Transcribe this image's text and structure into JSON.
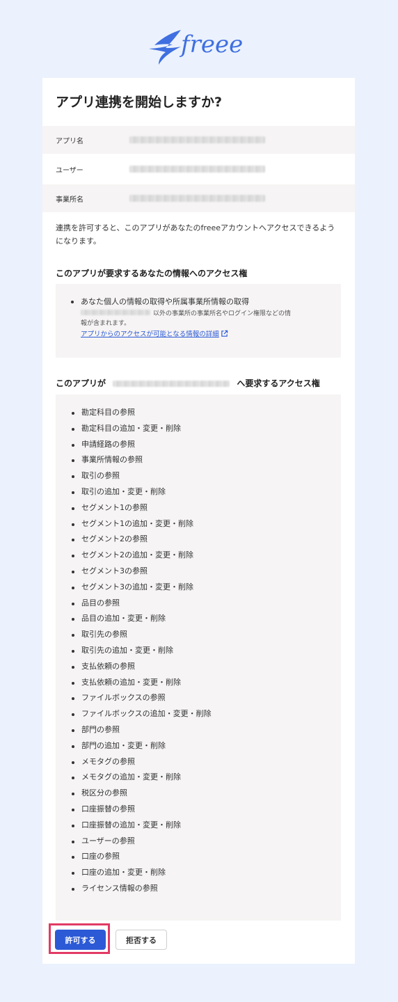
{
  "brand": {
    "name": "freee",
    "color": "#3f6fe0"
  },
  "page": {
    "title": "アプリ連携を開始しますか?"
  },
  "info": [
    {
      "label": "アプリ名"
    },
    {
      "label": "ユーザー"
    },
    {
      "label": "事業所名"
    }
  ],
  "description": "連携を許可すると、このアプリがあなたのfreeeアカウントへアクセスできるようになります。",
  "personal_access": {
    "title": "このアプリが要求するあなたの情報へのアクセス権",
    "item": "あなた個人の情報の取得や所属事業所情報の取得",
    "note_line1": "以外の事業所の事業所名やログイン権限などの情",
    "note_line2": "報が含まれます。",
    "link": "アプリからのアクセスが可能となる情報の詳細"
  },
  "company_access": {
    "title_prefix": "このアプリが",
    "title_suffix": "へ要求するアクセス権",
    "items": [
      "勘定科目の参照",
      "勘定科目の追加・変更・削除",
      "申請経路の参照",
      "事業所情報の参照",
      "取引の参照",
      "取引の追加・変更・削除",
      "セグメント1の参照",
      "セグメント1の追加・変更・削除",
      "セグメント2の参照",
      "セグメント2の追加・変更・削除",
      "セグメント3の参照",
      "セグメント3の追加・変更・削除",
      "品目の参照",
      "品目の追加・変更・削除",
      "取引先の参照",
      "取引先の追加・変更・削除",
      "支払依頼の参照",
      "支払依頼の追加・変更・削除",
      "ファイルボックスの参照",
      "ファイルボックスの追加・変更・削除",
      "部門の参照",
      "部門の追加・変更・削除",
      "メモタグの参照",
      "メモタグの追加・変更・削除",
      "税区分の参照",
      "口座振替の参照",
      "口座振替の追加・変更・削除",
      "ユーザーの参照",
      "口座の参照",
      "口座の追加・変更・削除",
      "ライセンス情報の参照"
    ]
  },
  "buttons": {
    "allow": "許可する",
    "deny": "拒否する"
  },
  "colors": {
    "primary": "#2c5ad6",
    "highlight": "#e23a64",
    "background": "#ebf2fd"
  }
}
